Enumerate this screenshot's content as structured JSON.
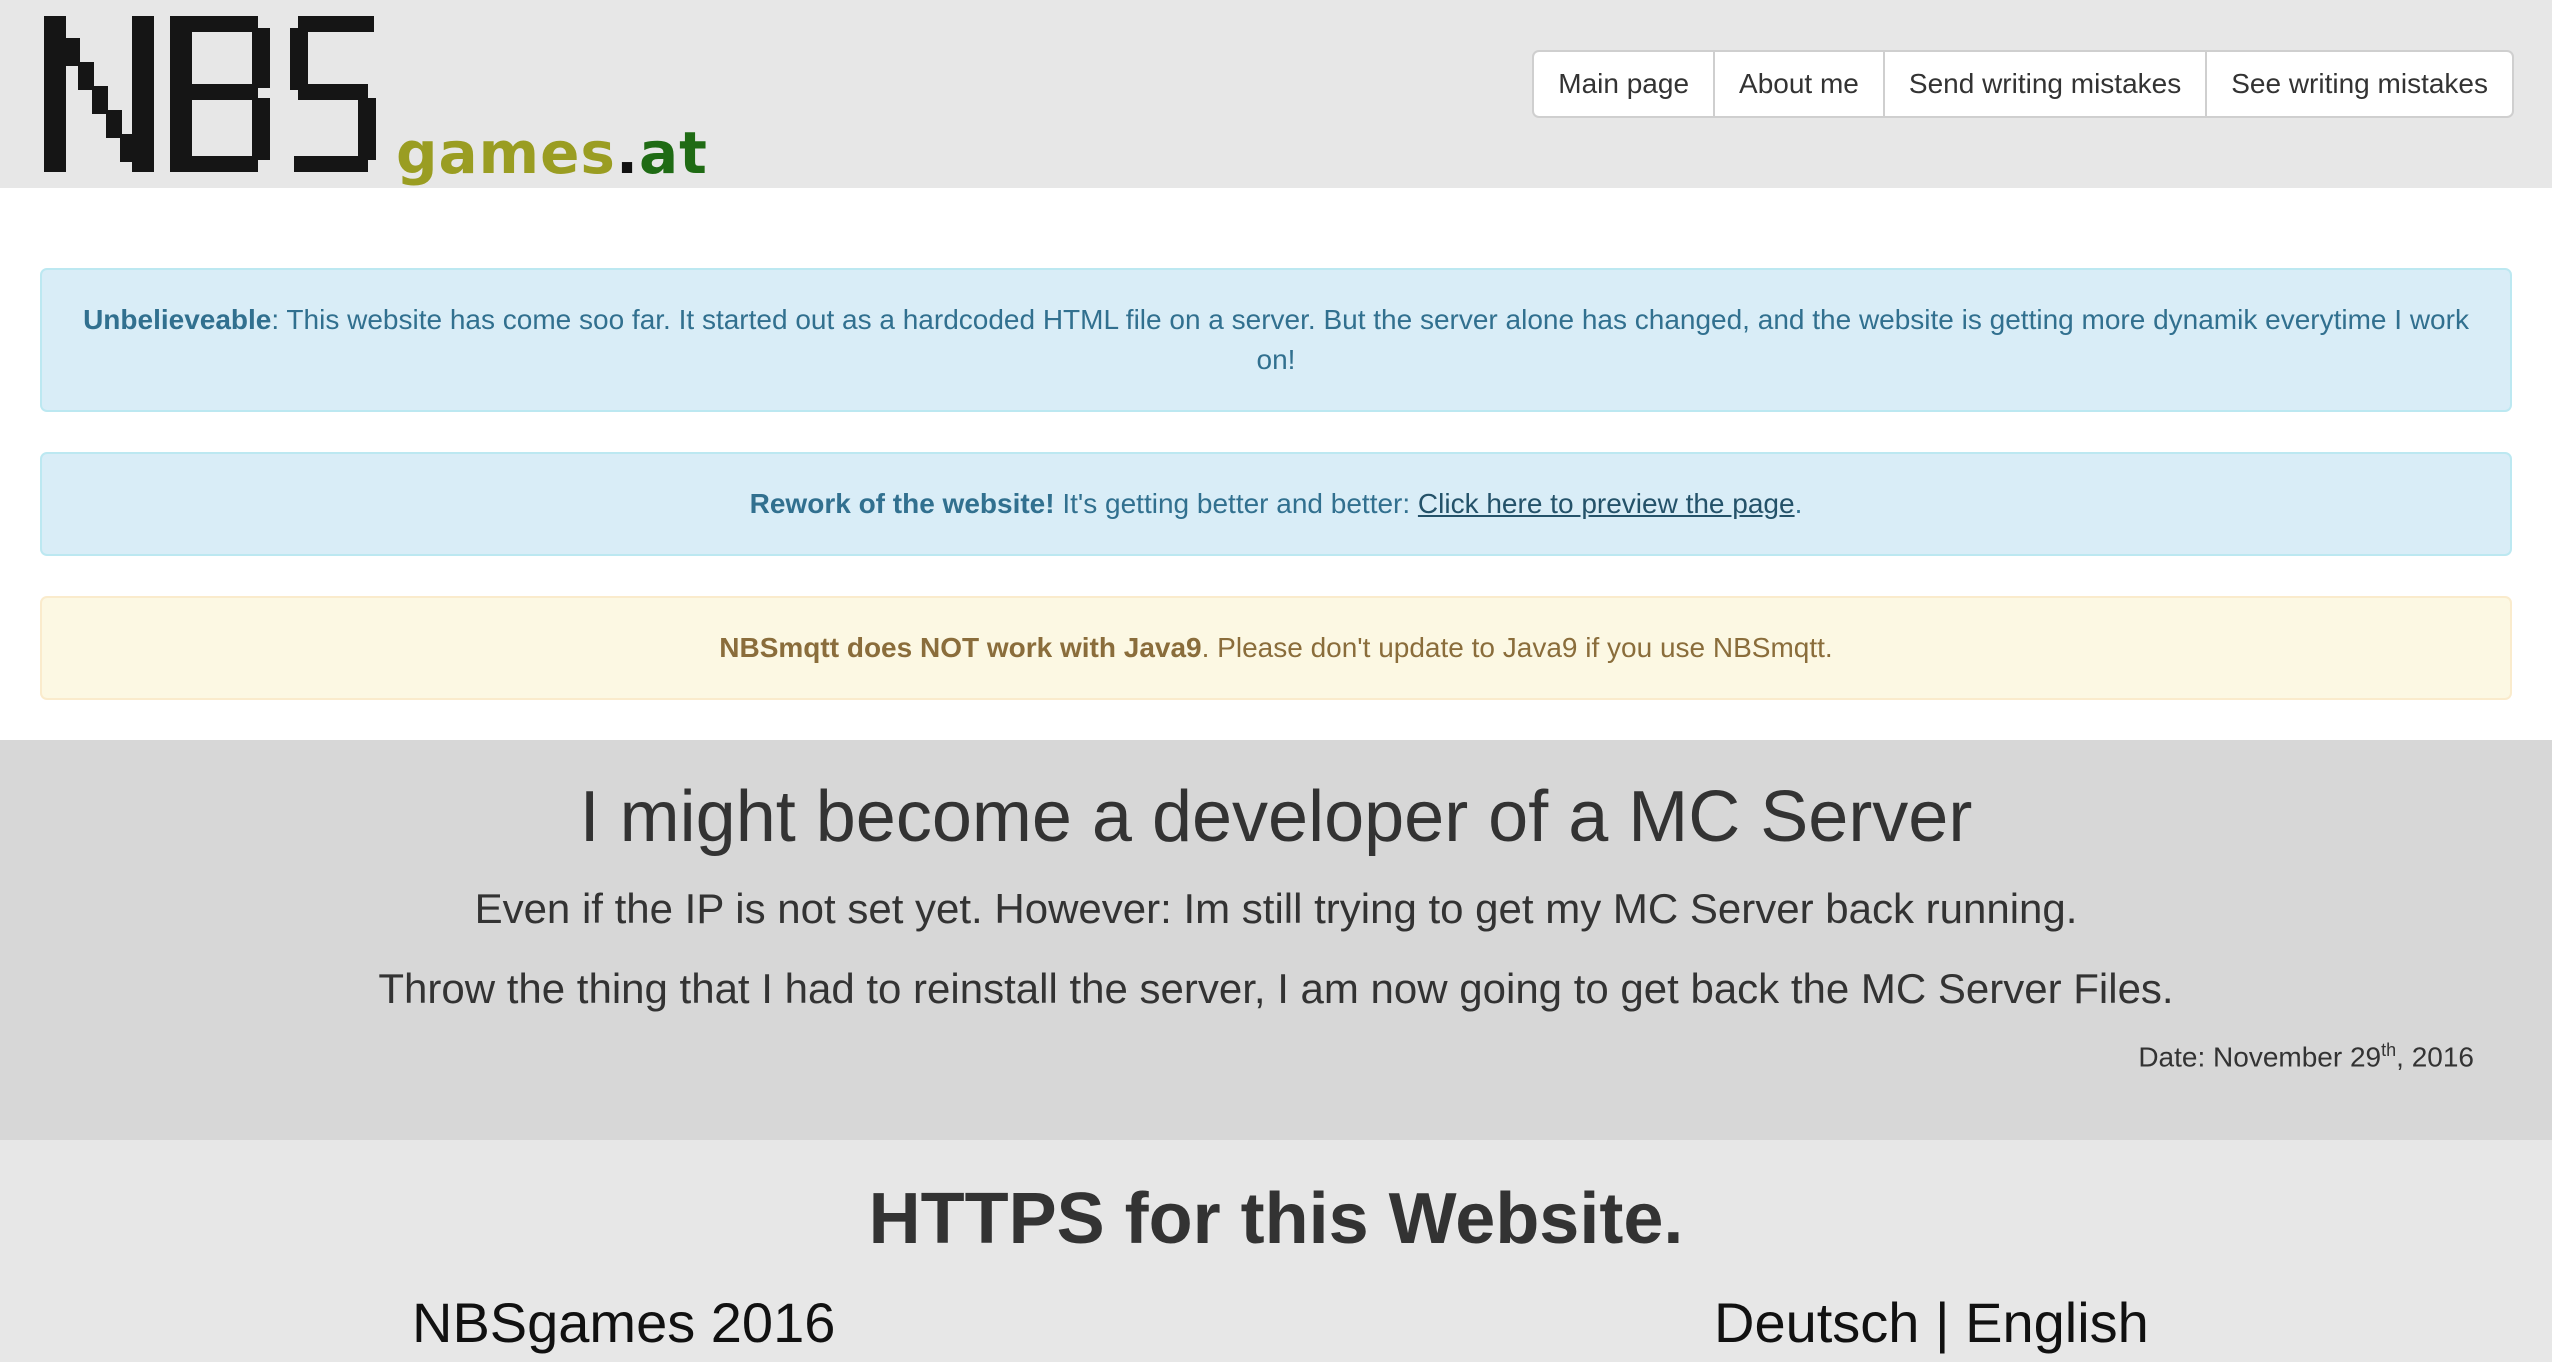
{
  "header": {
    "logo_text": "NBS",
    "logo_suffix": {
      "games": "games",
      "dot": ".",
      "at": "at"
    },
    "colors": {
      "games": "#9a9d22",
      "at": "#1f6b14"
    },
    "nav": [
      {
        "label": "Main page"
      },
      {
        "label": "About me"
      },
      {
        "label": "Send writing mistakes"
      },
      {
        "label": "See writing mistakes"
      }
    ]
  },
  "alerts": {
    "a1": {
      "bold": "Unbelieveable",
      "text": ": This website has come soo far. It started out as a hardcoded HTML file on a server. But the server alone has changed, and the website is getting more dynamik everytime I work on!"
    },
    "a2": {
      "bold": "Rework of the website!",
      "text": " It's getting better and better: ",
      "link": "Click here to preview the page",
      "end": "."
    },
    "a3": {
      "bold": "NBSmqtt does NOT work with Java9",
      "text": ". Please don't update to Java9 if you use NBSmqtt."
    }
  },
  "news": {
    "title": "I might become a developer of a MC Server",
    "line1": "Even if the IP is not set yet. However: Im still trying to get my MC Server back running.",
    "line2": "Throw the thing that I had to reinstall the server, I am now going to get back the MC Server Files.",
    "date_prefix": "Date: November 29",
    "date_sup": "th",
    "date_suffix": ", 2016"
  },
  "section2": {
    "title": "HTTPS for this Website."
  },
  "footer": {
    "copyright": "NBSgames 2016",
    "lang_de": "Deutsch",
    "separator": " | ",
    "lang_en": "English"
  }
}
